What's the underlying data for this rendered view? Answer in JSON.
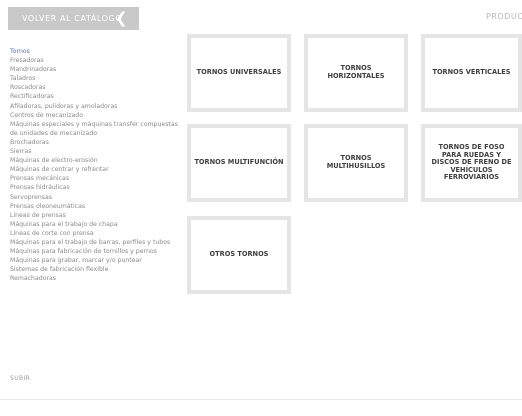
{
  "header": {
    "back_label": "VOLVER AL CATÁLOGO",
    "back_icon": "chevron-left-icon",
    "section_title": "PRODUCTOS"
  },
  "sidebar": {
    "items": [
      {
        "label": "Tornos",
        "active": true
      },
      {
        "label": "Fresadoras"
      },
      {
        "label": "Mandrinadoras"
      },
      {
        "label": "Taladros"
      },
      {
        "label": "Roscadoras"
      },
      {
        "label": "Rectificadoras"
      },
      {
        "label": "Afiladoras, pulidoras y amoladoras"
      },
      {
        "label": "Centros de mecanizado"
      },
      {
        "label": "Máquinas especiales y máquinas transfer compuestas"
      },
      {
        "label": "de unidades de mecanizado"
      },
      {
        "label": "Brochadoras"
      },
      {
        "label": "Sierras"
      },
      {
        "label": "Máquinas de electro-erosión"
      },
      {
        "label": "Máquinas de centrar y refrentar"
      },
      {
        "label": "Prensas mecánicas"
      },
      {
        "label": "Prensas hidráulicas"
      },
      {
        "label": "Servoprensas"
      },
      {
        "label": "Prensas oleoneumáticas"
      },
      {
        "label": "Líneas de prensas"
      },
      {
        "label": "Máquinas para el trabajo de chapa"
      },
      {
        "label": "Líneas de corte con prensa"
      },
      {
        "label": "Máquinas para el trabajo de barras, perfiles y tubos"
      },
      {
        "label": "Máquinas para fabricación de tornillos y pernos"
      },
      {
        "label": "Máquinas para grabar, marcar y/o puntear"
      },
      {
        "label": "Sistemas de fabricación flexible"
      },
      {
        "label": "Remachadoras"
      }
    ],
    "scroll_up_label": "SUBIR"
  },
  "main": {
    "products": [
      {
        "label": "TORNOS UNIVERSALES"
      },
      {
        "label": "TORNOS HORIZONTALES"
      },
      {
        "label": "TORNOS VERTICALES"
      },
      {
        "label": "TORNOS MULTIFUNCIÓN"
      },
      {
        "label": "TORNOS MULTIHUSILLOS"
      },
      {
        "label": "TORNOS DE FOSO PARA RUEDAS Y DISCOS DE FRENO DE VEHÍCULOS FERROVIARIOS"
      },
      {
        "label": "OTROS TORNOS"
      }
    ]
  },
  "colors": {
    "accent": "#4a78b5",
    "button_bg": "#c9c9c9",
    "tile_border": "#e5e5e5",
    "text_gray": "#8a8a8a"
  }
}
